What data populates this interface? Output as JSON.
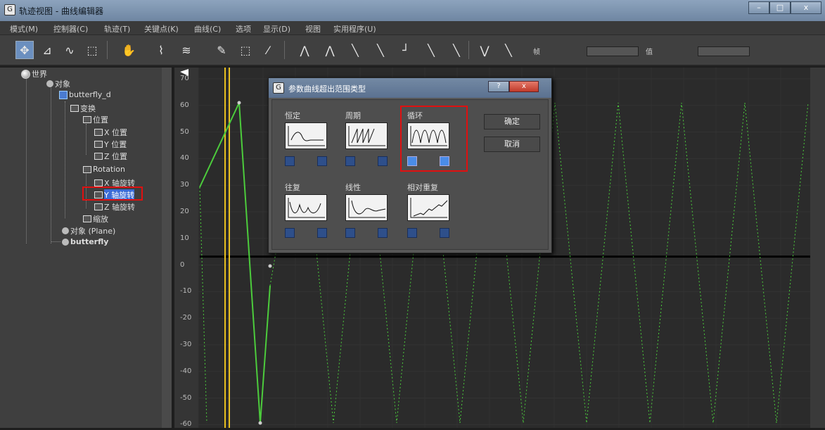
{
  "window": {
    "title": "轨迹视图 - 曲线编辑器",
    "minimize": "–",
    "restore": "□",
    "close": "x"
  },
  "menu": [
    "模式(M)",
    "控制器(C)",
    "轨迹(T)",
    "关键点(K)",
    "曲线(C)",
    "选项",
    "显示(D)",
    "视图",
    "实用程序(U)"
  ],
  "toolbar": {
    "frame_label": "帧",
    "value_label": "值"
  },
  "tree": {
    "world": "世界",
    "objects": "对象",
    "butterfly_d": "butterfly_d",
    "transform": "变换",
    "position": "位置",
    "x_position": "X 位置",
    "y_position": "Y 位置",
    "z_position": "Z 位置",
    "rotation": "Rotation",
    "x_rotation": "X 轴旋转",
    "y_rotation": "Y 轴旋转",
    "z_rotation": "Z 轴旋转",
    "scale": "缩放",
    "plane": "对象 (Plane)",
    "butterfly": "butterfly"
  },
  "graph": {
    "y_ticks": [
      "70",
      "60",
      "50",
      "40",
      "30",
      "20",
      "10",
      "0",
      "-10",
      "-20",
      "-30",
      "-40",
      "-50",
      "-60"
    ]
  },
  "dialog": {
    "title": "参数曲线超出范围类型",
    "help": "?",
    "close": "x",
    "ok": "确定",
    "cancel": "取消",
    "options": [
      {
        "label": "恒定",
        "selected": false
      },
      {
        "label": "周期",
        "selected": false
      },
      {
        "label": "循环",
        "selected": true
      },
      {
        "label": "往复",
        "selected": false
      },
      {
        "label": "线性",
        "selected": false
      },
      {
        "label": "相对重复",
        "selected": false
      }
    ]
  },
  "colors": {
    "curve": "#4ccc3c",
    "time_marker": "#e8c020",
    "highlight": "#e01010",
    "selection": "#3b6bd6"
  }
}
